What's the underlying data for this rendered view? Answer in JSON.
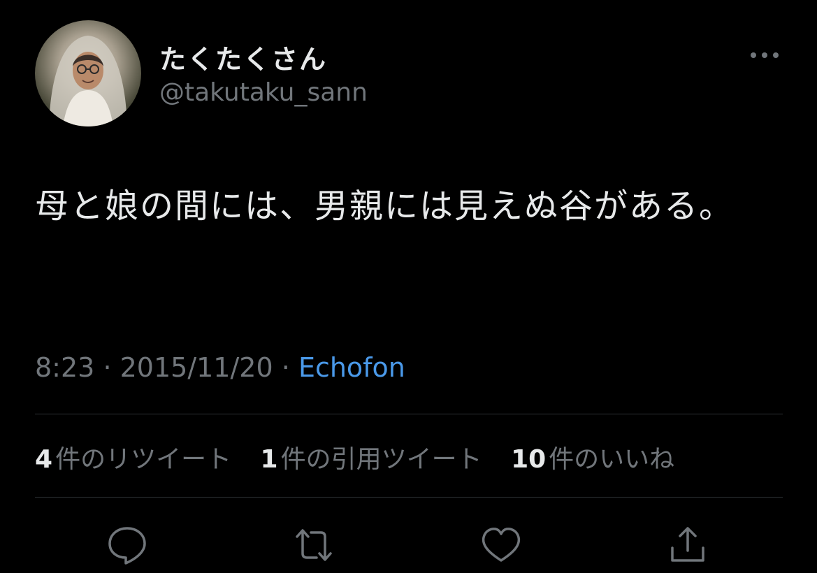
{
  "user": {
    "display_name": "たくたくさん",
    "handle": "@takutaku_sann"
  },
  "tweet": {
    "text": "母と娘の間には、男親には見えぬ谷がある。"
  },
  "meta": {
    "time": "8:23",
    "separator": "·",
    "date": "2015/11/20",
    "source": "Echofon"
  },
  "stats": {
    "retweets_count": "4",
    "retweets_label": "件のリツイート",
    "quotes_count": "1",
    "quotes_label": "件の引用ツイート",
    "likes_count": "10",
    "likes_label": "件のいいね"
  },
  "icons": {
    "more": "more-horizontal-icon",
    "reply": "reply-icon",
    "retweet": "retweet-icon",
    "like": "heart-icon",
    "share": "share-icon"
  },
  "colors": {
    "background": "#000000",
    "primary_text": "#e7e9ea",
    "secondary_text": "#71767b",
    "link": "#4a99e9",
    "divider": "#2f3336"
  }
}
